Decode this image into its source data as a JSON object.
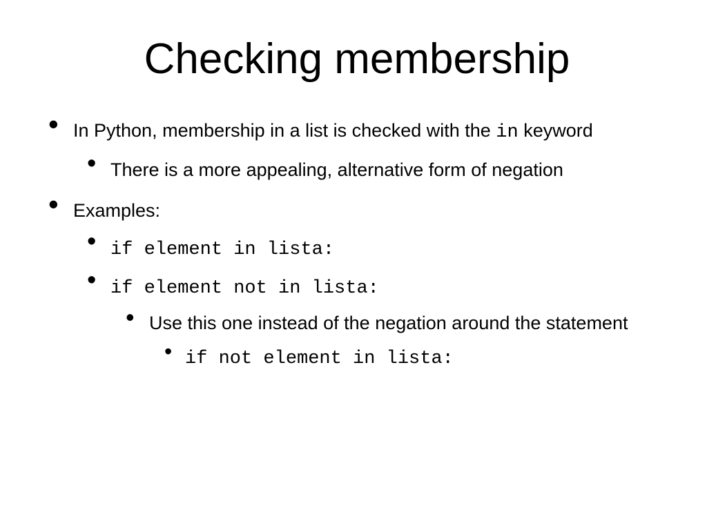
{
  "title": "Checking membership",
  "bullets": {
    "b1_pre": "In Python, membership in a list is checked with the ",
    "b1_code": "in",
    "b1_post": " keyword",
    "b1_1": "There is a more appealing, alternative form of negation",
    "b2": "Examples:",
    "b2_1": "if element in lista:",
    "b2_2": "if element not in lista:",
    "b2_2_1": "Use this one instead of the negation around the statement",
    "b2_2_1_1": "if not element in lista:"
  }
}
